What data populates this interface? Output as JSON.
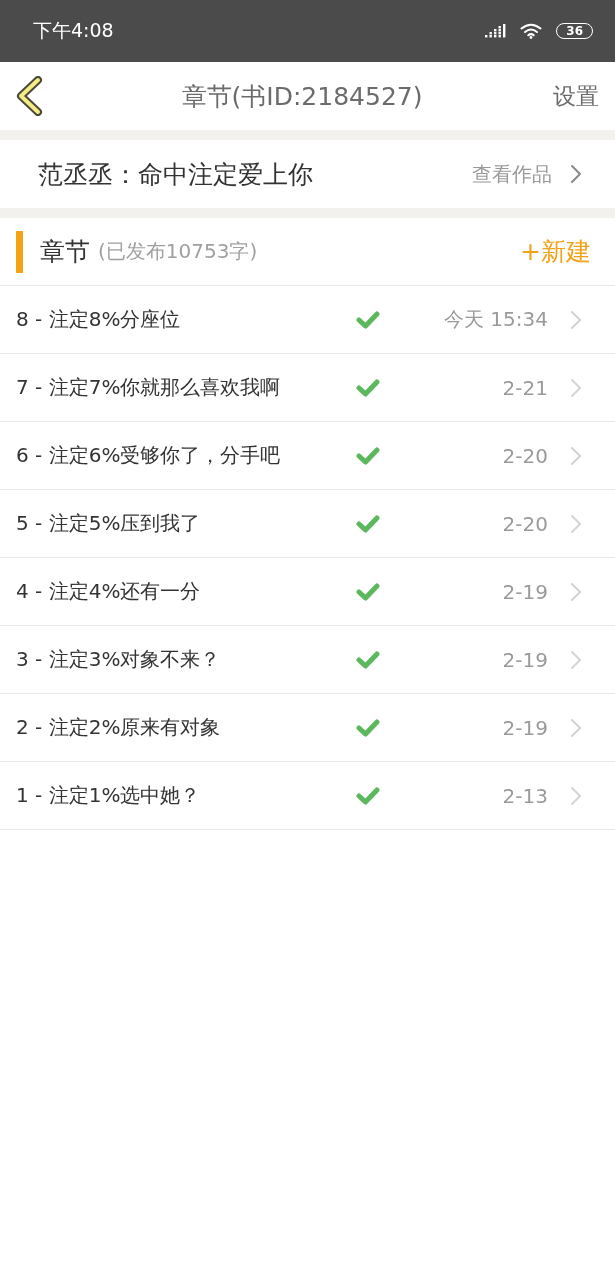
{
  "status_bar": {
    "time": "下午4:08",
    "battery": "36"
  },
  "nav_bar": {
    "title": "章节(书ID:2184527)",
    "action": "设置"
  },
  "book": {
    "title": "范丞丞：命中注定爱上你",
    "link": "查看作品"
  },
  "section": {
    "title": "章节",
    "subtitle": "(已发布10753字)",
    "action": "+新建"
  },
  "chapters": [
    {
      "title": "8 - 注定8%分座位",
      "published": true,
      "date": "今天 15:34"
    },
    {
      "title": "7 - 注定7%你就那么喜欢我啊",
      "published": true,
      "date": "2-21"
    },
    {
      "title": "6 - 注定6%受够你了，分手吧",
      "published": true,
      "date": "2-20"
    },
    {
      "title": "5 - 注定5%压到我了",
      "published": true,
      "date": "2-20"
    },
    {
      "title": "4 - 注定4%还有一分",
      "published": true,
      "date": "2-19"
    },
    {
      "title": "3 - 注定3%对象不来？",
      "published": true,
      "date": "2-19"
    },
    {
      "title": "2 - 注定2%原来有对象",
      "published": true,
      "date": "2-19"
    },
    {
      "title": "1 - 注定1%选中她？",
      "published": true,
      "date": "2-13"
    }
  ]
}
